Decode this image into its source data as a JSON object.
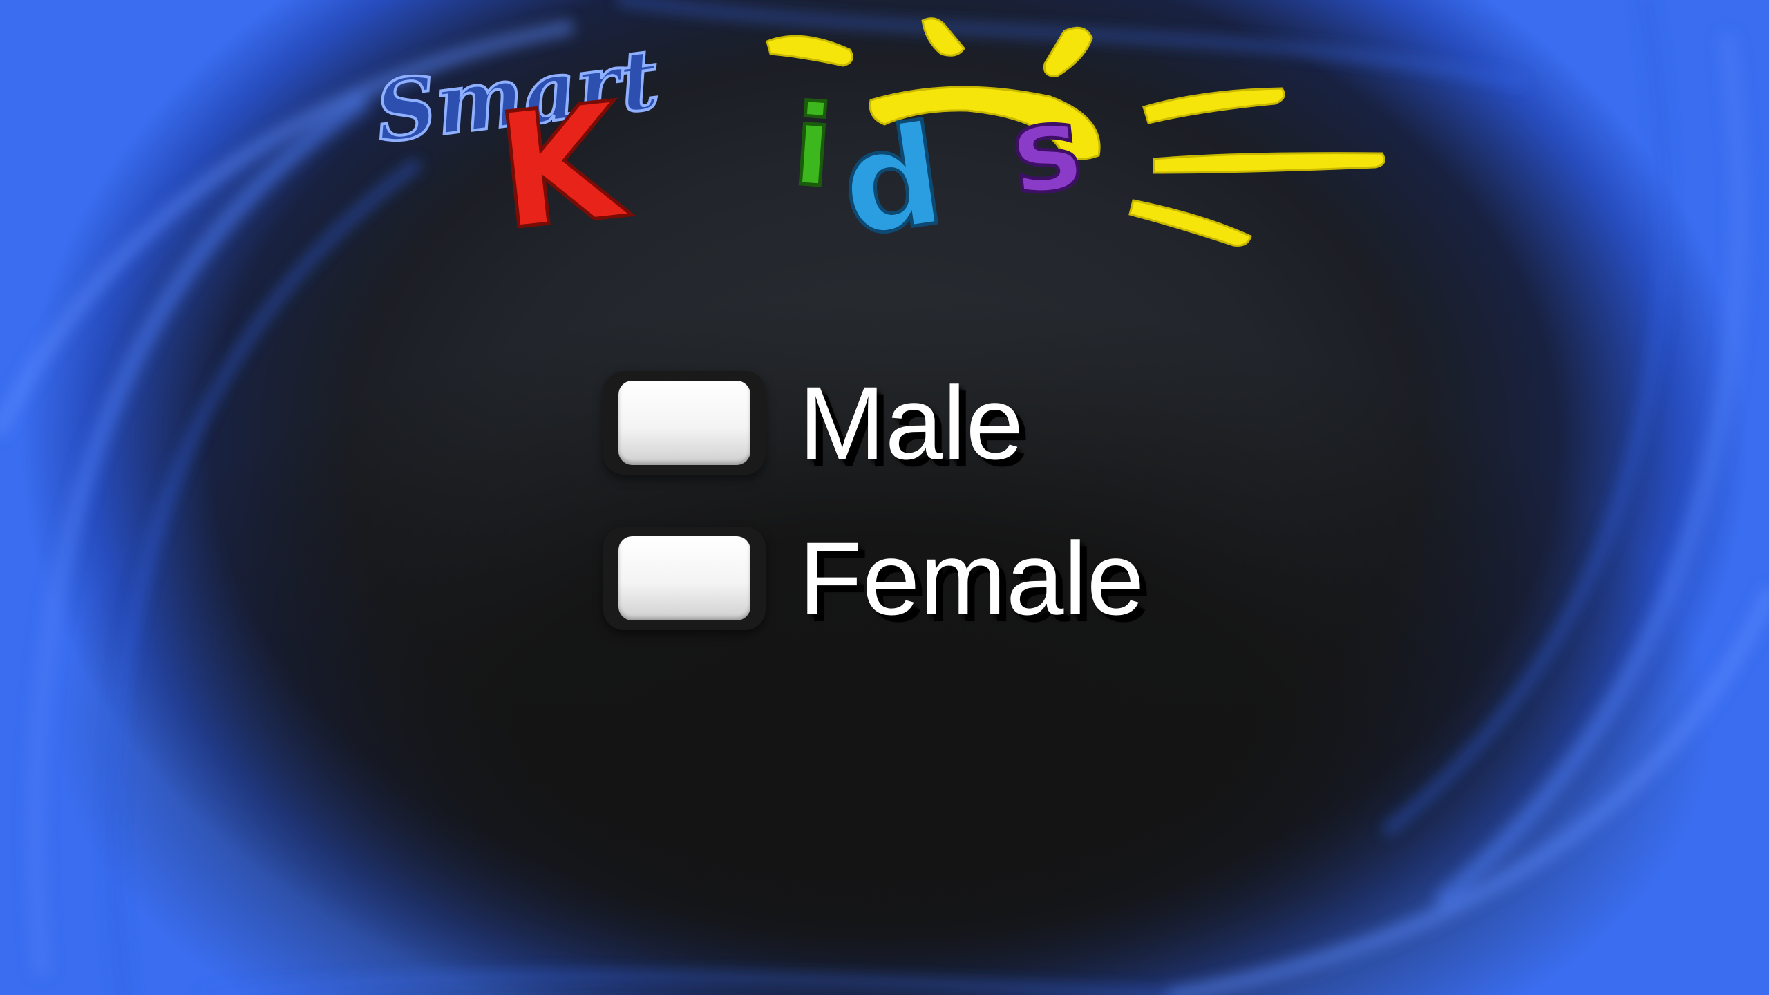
{
  "logo": {
    "line1": "Smart",
    "line2_letters": [
      "K",
      "i",
      "d",
      "s"
    ]
  },
  "gender_options": [
    {
      "label": "Male",
      "checked": false
    },
    {
      "label": "Female",
      "checked": false
    }
  ],
  "colors": {
    "background": "#141414",
    "swirl_blue": "#3a6df0",
    "label_text": "#ffffff",
    "checkbox_face": "#f4f4f4",
    "logo_smart": "#2d4fb0",
    "logo_K": "#e8241a",
    "logo_i": "#3cb81e",
    "logo_d": "#2a9ee0",
    "logo_s": "#8a3cc8",
    "logo_sun": "#f5e50a"
  }
}
